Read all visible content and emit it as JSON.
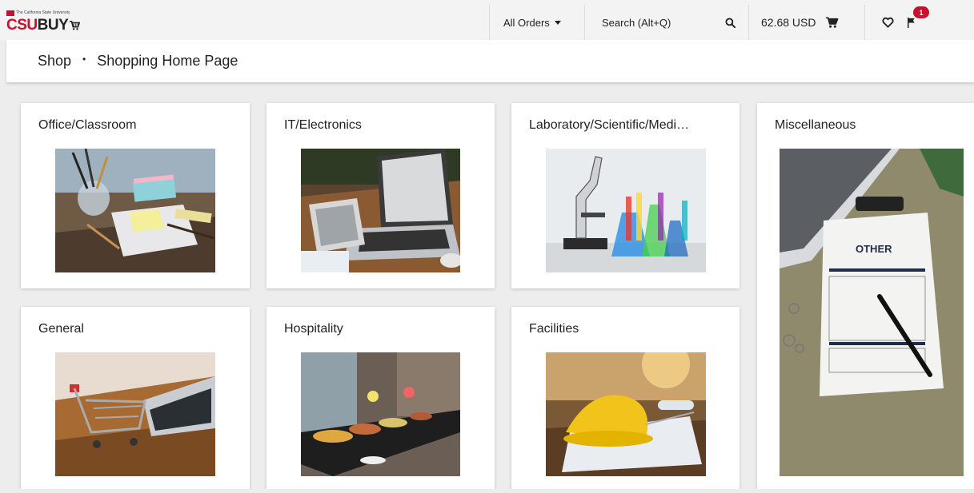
{
  "header": {
    "logo": {
      "brand_prefix": "CSU",
      "brand_suffix": "BUY",
      "tagline": "The California State University"
    },
    "orders_menu_label": "All Orders",
    "search_placeholder": "Search (Alt+Q)",
    "cart_total": "62.68 USD",
    "flag_badge_count": "1",
    "notification_badge_count": "1",
    "icons": {
      "orders_dropdown": "chevron-down-icon",
      "search": "search-icon",
      "cart": "cart-icon",
      "favorites": "heart-icon",
      "action_items": "flag-icon",
      "notifications": "bell-icon"
    }
  },
  "breadcrumb": {
    "root": "Shop",
    "separator": "•",
    "current": "Shopping Home Page"
  },
  "categories": [
    {
      "title": "Office/Classroom",
      "image": "office-supplies-photo"
    },
    {
      "title": "IT/Electronics",
      "image": "laptop-tablet-photo"
    },
    {
      "title": "Laboratory/Scientific/Medi…",
      "image": "microscope-flasks-photo"
    },
    {
      "title": "Miscellaneous",
      "image": "other-clipboard-photo",
      "image_text": "OTHER"
    },
    {
      "title": "General",
      "image": "shopping-cart-laptop-photo"
    },
    {
      "title": "Hospitality",
      "image": "buffet-table-photo"
    },
    {
      "title": "Facilities",
      "image": "hard-hat-blueprints-photo"
    }
  ],
  "colors": {
    "brand_red": "#c8102e",
    "page_background": "#ededed",
    "header_background": "#f3f3f3"
  }
}
